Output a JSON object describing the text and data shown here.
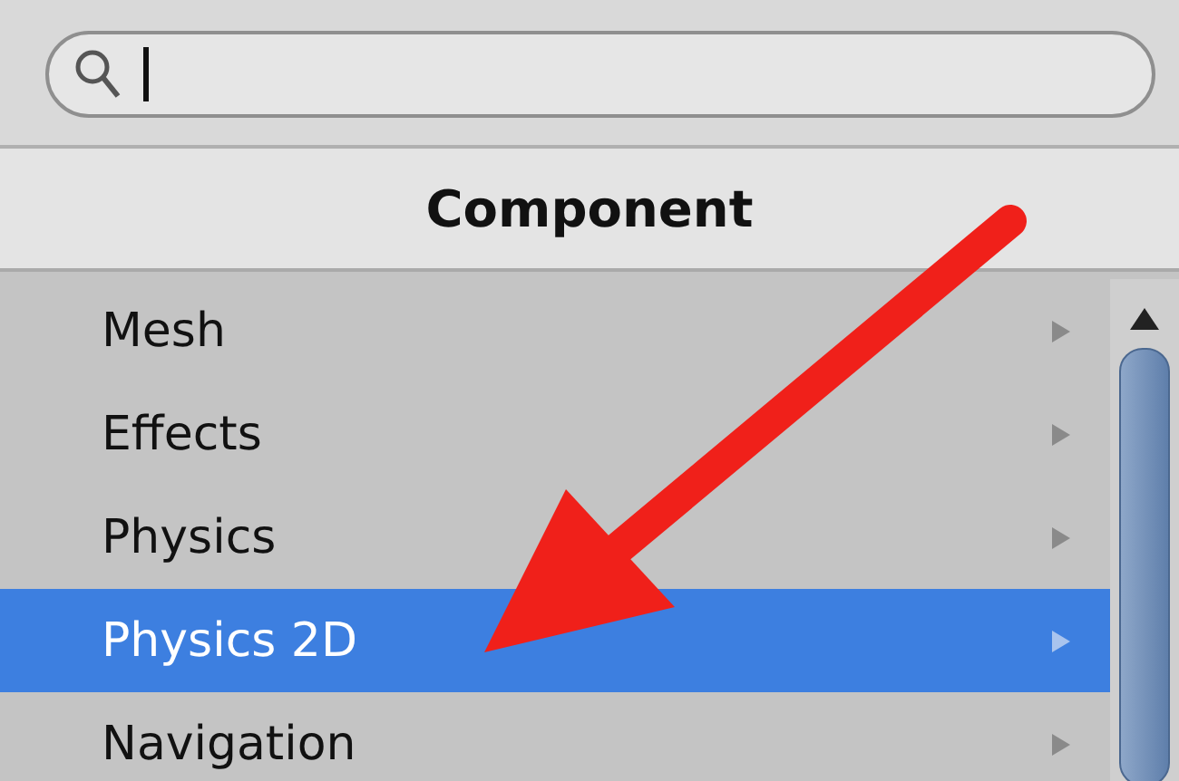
{
  "search": {
    "focused": true
  },
  "header": {
    "title": "Component"
  },
  "items": [
    {
      "label": "Mesh",
      "selected": false
    },
    {
      "label": "Effects",
      "selected": false
    },
    {
      "label": "Physics",
      "selected": false
    },
    {
      "label": "Physics 2D",
      "selected": true
    },
    {
      "label": "Navigation",
      "selected": false
    }
  ]
}
